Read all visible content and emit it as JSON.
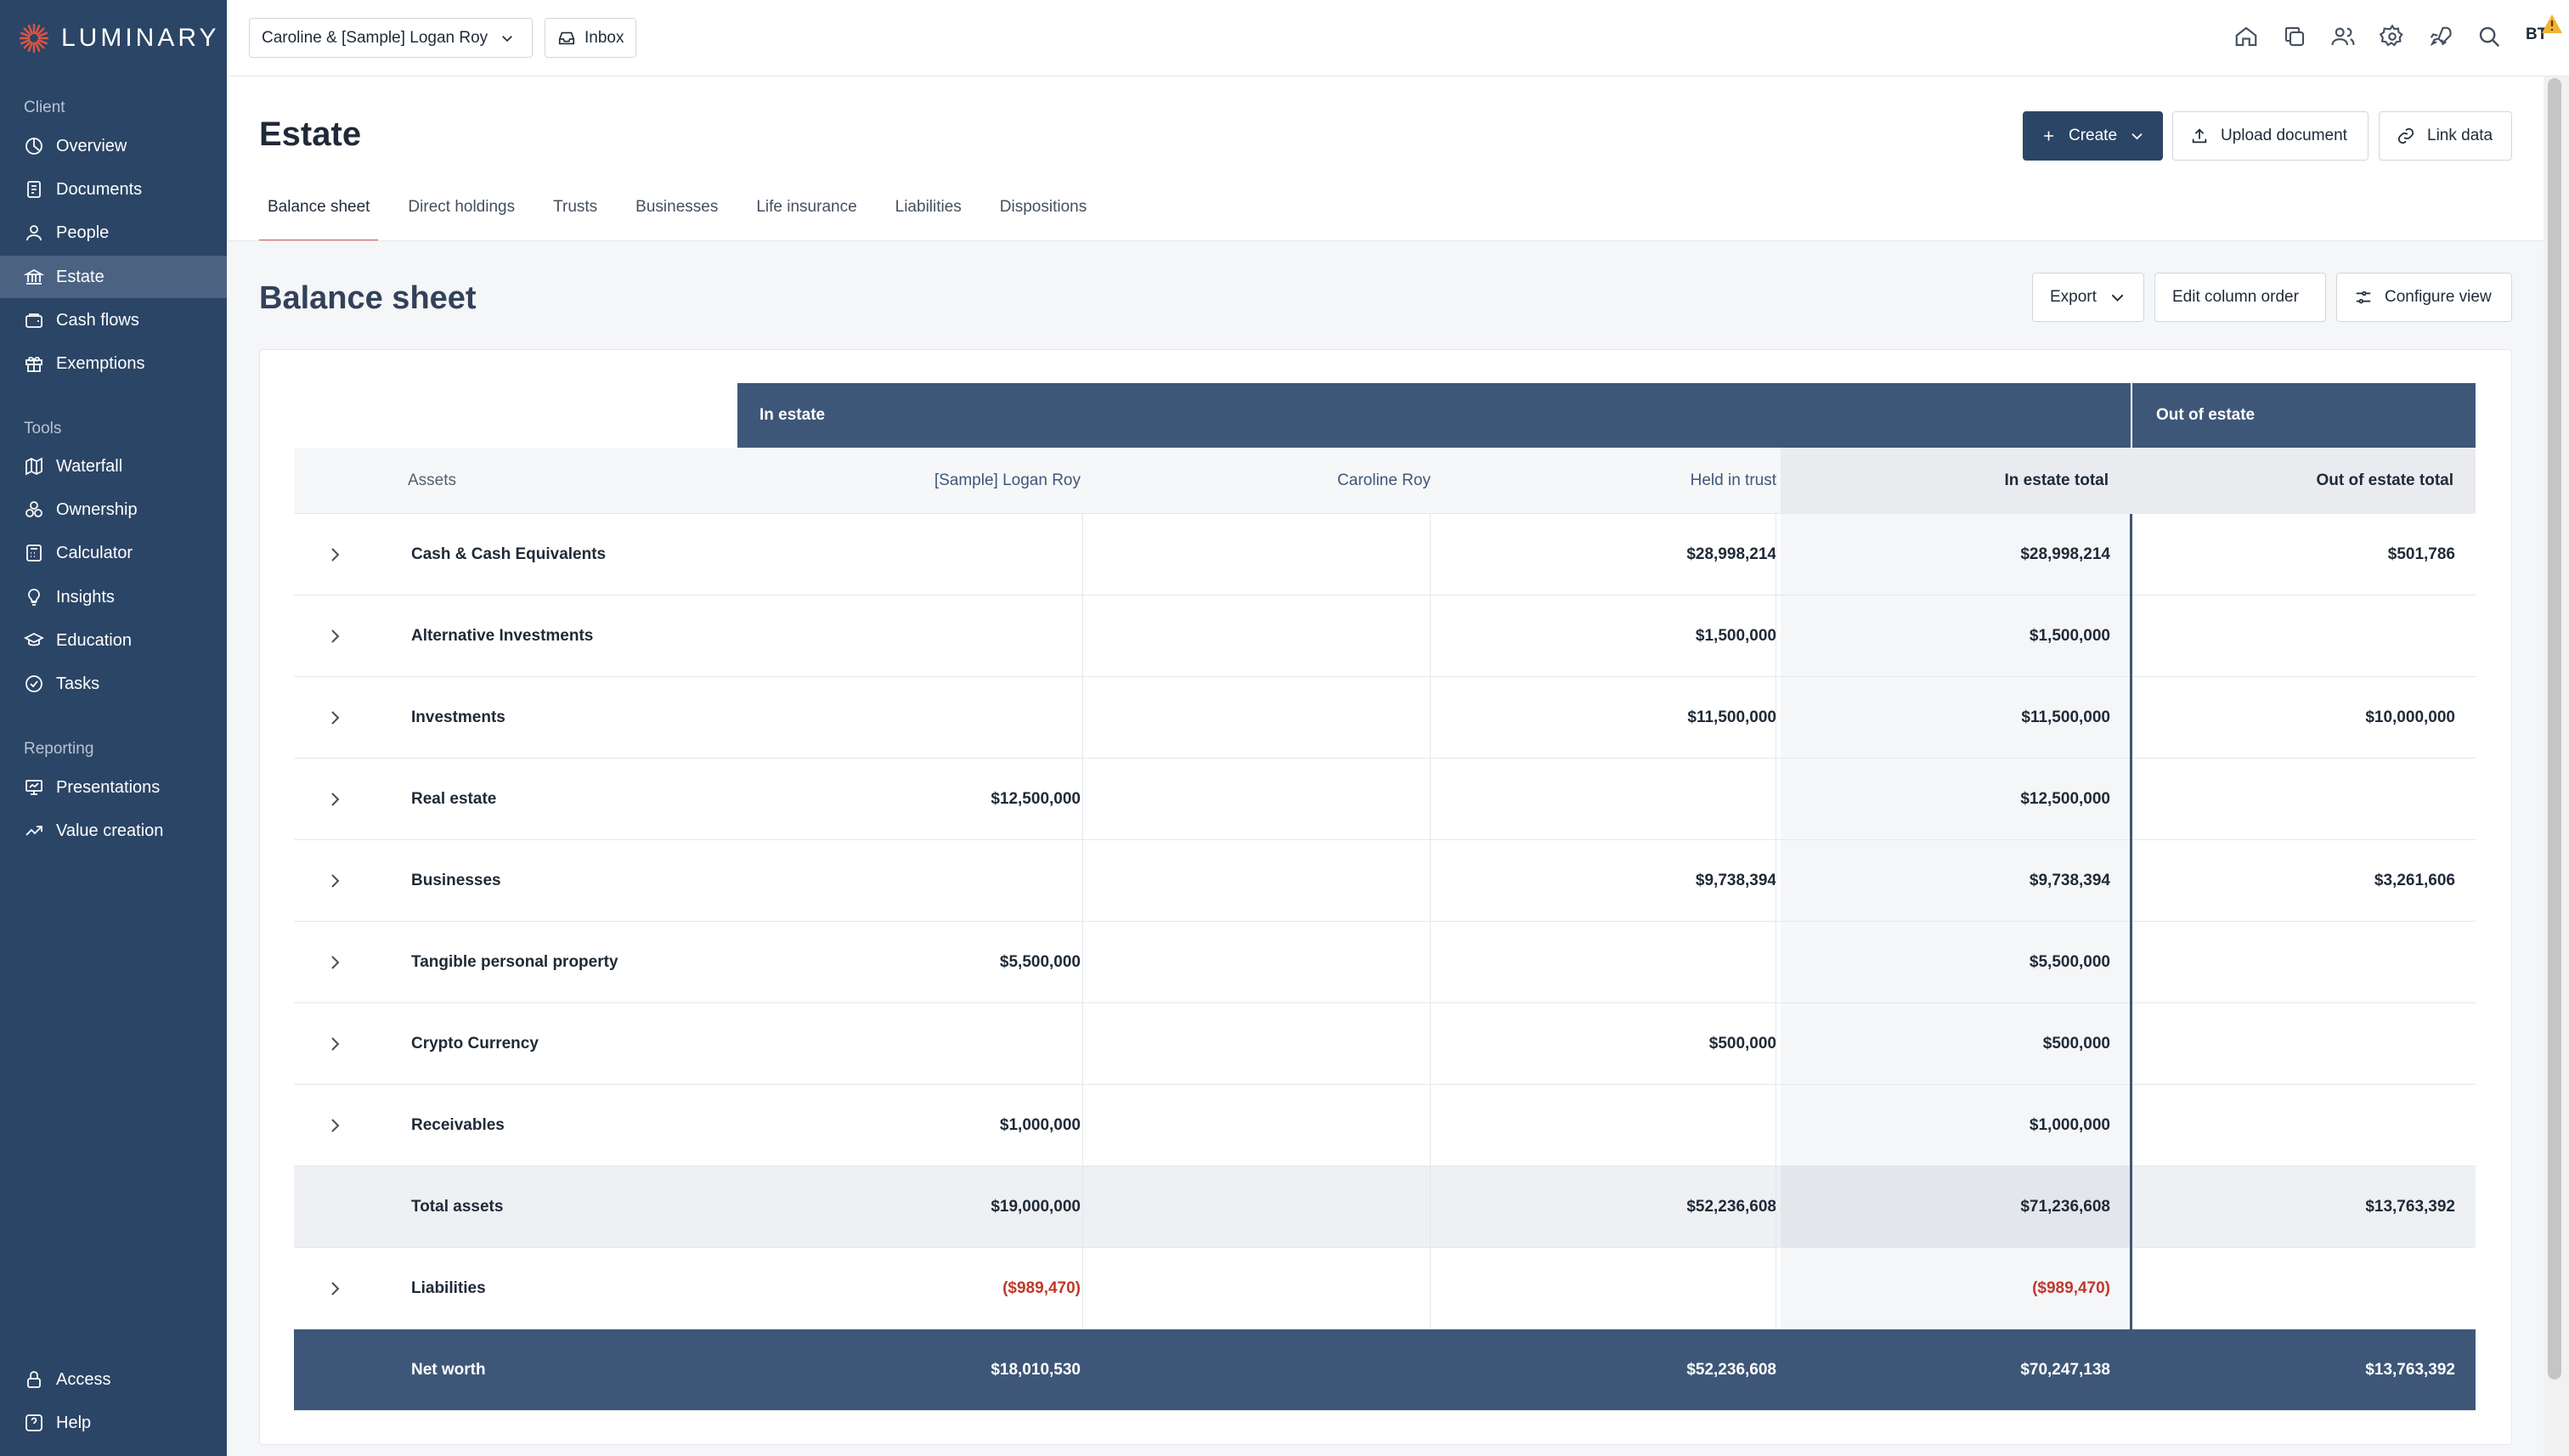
{
  "brand": {
    "name": "LUMINARY"
  },
  "sidebar": {
    "sections": [
      {
        "label": "Client",
        "items": [
          {
            "label": "Overview",
            "icon": "overview-icon"
          },
          {
            "label": "Documents",
            "icon": "documents-icon"
          },
          {
            "label": "People",
            "icon": "person-icon"
          },
          {
            "label": "Estate",
            "icon": "bank-icon",
            "active": true
          },
          {
            "label": "Cash flows",
            "icon": "wallet-icon"
          },
          {
            "label": "Exemptions",
            "icon": "gift-icon"
          }
        ]
      },
      {
        "label": "Tools",
        "items": [
          {
            "label": "Waterfall",
            "icon": "map-icon"
          },
          {
            "label": "Ownership",
            "icon": "ownership-icon"
          },
          {
            "label": "Calculator",
            "icon": "calculator-icon"
          },
          {
            "label": "Insights",
            "icon": "lightbulb-icon"
          },
          {
            "label": "Education",
            "icon": "graduation-cap-icon"
          },
          {
            "label": "Tasks",
            "icon": "check-circle-icon"
          }
        ]
      },
      {
        "label": "Reporting",
        "items": [
          {
            "label": "Presentations",
            "icon": "presentation-icon"
          },
          {
            "label": "Value creation",
            "icon": "trend-up-icon"
          }
        ]
      }
    ],
    "footer": [
      {
        "label": "Access",
        "icon": "lock-icon"
      },
      {
        "label": "Help",
        "icon": "help-icon"
      }
    ]
  },
  "topbar": {
    "client": "Caroline & [Sample] Logan Roy",
    "inbox": "Inbox",
    "user_initials": "BT"
  },
  "page": {
    "title": "Estate",
    "buttons": {
      "create": "Create",
      "upload": "Upload document",
      "link": "Link data"
    },
    "tabs": [
      "Balance sheet",
      "Direct holdings",
      "Trusts",
      "Businesses",
      "Life insurance",
      "Liabilities",
      "Dispositions"
    ],
    "active_tab": 0
  },
  "balance_sheet": {
    "title": "Balance sheet",
    "actions": {
      "export": "Export",
      "edit_columns": "Edit column order",
      "configure": "Configure view"
    },
    "groups": {
      "in_estate": "In estate",
      "out_of_estate": "Out of estate"
    },
    "columns": [
      "Assets",
      "[Sample] Logan Roy",
      "Caroline Roy",
      "Held in trust",
      "In estate total",
      "Out of estate total"
    ],
    "rows": [
      {
        "label": "Cash & Cash Equivalents",
        "logan": "",
        "caroline": "",
        "trust": "$28,998,214",
        "in_total": "$28,998,214",
        "out_total": "$501,786"
      },
      {
        "label": "Alternative Investments",
        "logan": "",
        "caroline": "",
        "trust": "$1,500,000",
        "in_total": "$1,500,000",
        "out_total": ""
      },
      {
        "label": "Investments",
        "logan": "",
        "caroline": "",
        "trust": "$11,500,000",
        "in_total": "$11,500,000",
        "out_total": "$10,000,000"
      },
      {
        "label": "Real estate",
        "logan": "$12,500,000",
        "caroline": "",
        "trust": "",
        "in_total": "$12,500,000",
        "out_total": ""
      },
      {
        "label": "Businesses",
        "logan": "",
        "caroline": "",
        "trust": "$9,738,394",
        "in_total": "$9,738,394",
        "out_total": "$3,261,606"
      },
      {
        "label": "Tangible personal property",
        "logan": "$5,500,000",
        "caroline": "",
        "trust": "",
        "in_total": "$5,500,000",
        "out_total": ""
      },
      {
        "label": "Crypto Currency",
        "logan": "",
        "caroline": "",
        "trust": "$500,000",
        "in_total": "$500,000",
        "out_total": ""
      },
      {
        "label": "Receivables",
        "logan": "$1,000,000",
        "caroline": "",
        "trust": "",
        "in_total": "$1,000,000",
        "out_total": ""
      }
    ],
    "total_assets": {
      "label": "Total assets",
      "logan": "$19,000,000",
      "caroline": "",
      "trust": "$52,236,608",
      "in_total": "$71,236,608",
      "out_total": "$13,763,392"
    },
    "liabilities": {
      "label": "Liabilities",
      "logan": "($989,470)",
      "caroline": "",
      "trust": "",
      "in_total": "($989,470)",
      "out_total": ""
    },
    "net_worth": {
      "label": "Net worth",
      "logan": "$18,010,530",
      "caroline": "",
      "trust": "$52,236,608",
      "in_total": "$70,247,138",
      "out_total": "$13,763,392"
    }
  },
  "colors": {
    "sidebar": "#2b4566",
    "sidebar_active": "#4b6283",
    "header_band": "#3e5778",
    "tab_underline": "#d9534f",
    "negative": "#c0392b"
  }
}
